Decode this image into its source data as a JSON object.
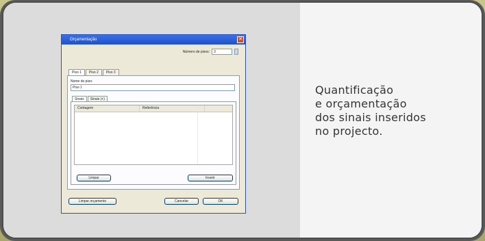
{
  "caption": {
    "lines": [
      "Quantificação",
      "e orçamentação",
      "dos sinais inseridos",
      "no projecto."
    ]
  },
  "dialog": {
    "title": "Orçamentação",
    "close_glyph": "✕",
    "num_pisos_label": "Número de pisos:",
    "num_pisos_value": "3",
    "tabs": [
      "Piso 1",
      "Piso 2",
      "Piso 3"
    ],
    "nome_piso_label": "Nome do piso:",
    "nome_piso_value": "Piso 1",
    "subtabs": [
      "Sinais",
      "Sinais (+)"
    ],
    "columns": [
      "Contagem",
      "Referência"
    ],
    "buttons": {
      "limpar": "Limpar",
      "inserir": "Inserir",
      "limpar_orcamento": "Limpar orçamento",
      "cancelar": "Cancelar",
      "ok": "OK"
    }
  },
  "colors": {
    "title_bar": "#2d5fd8",
    "close": "#d9482f",
    "left_pane": "#dcdcdc",
    "right_pane": "#f4f4f4"
  }
}
